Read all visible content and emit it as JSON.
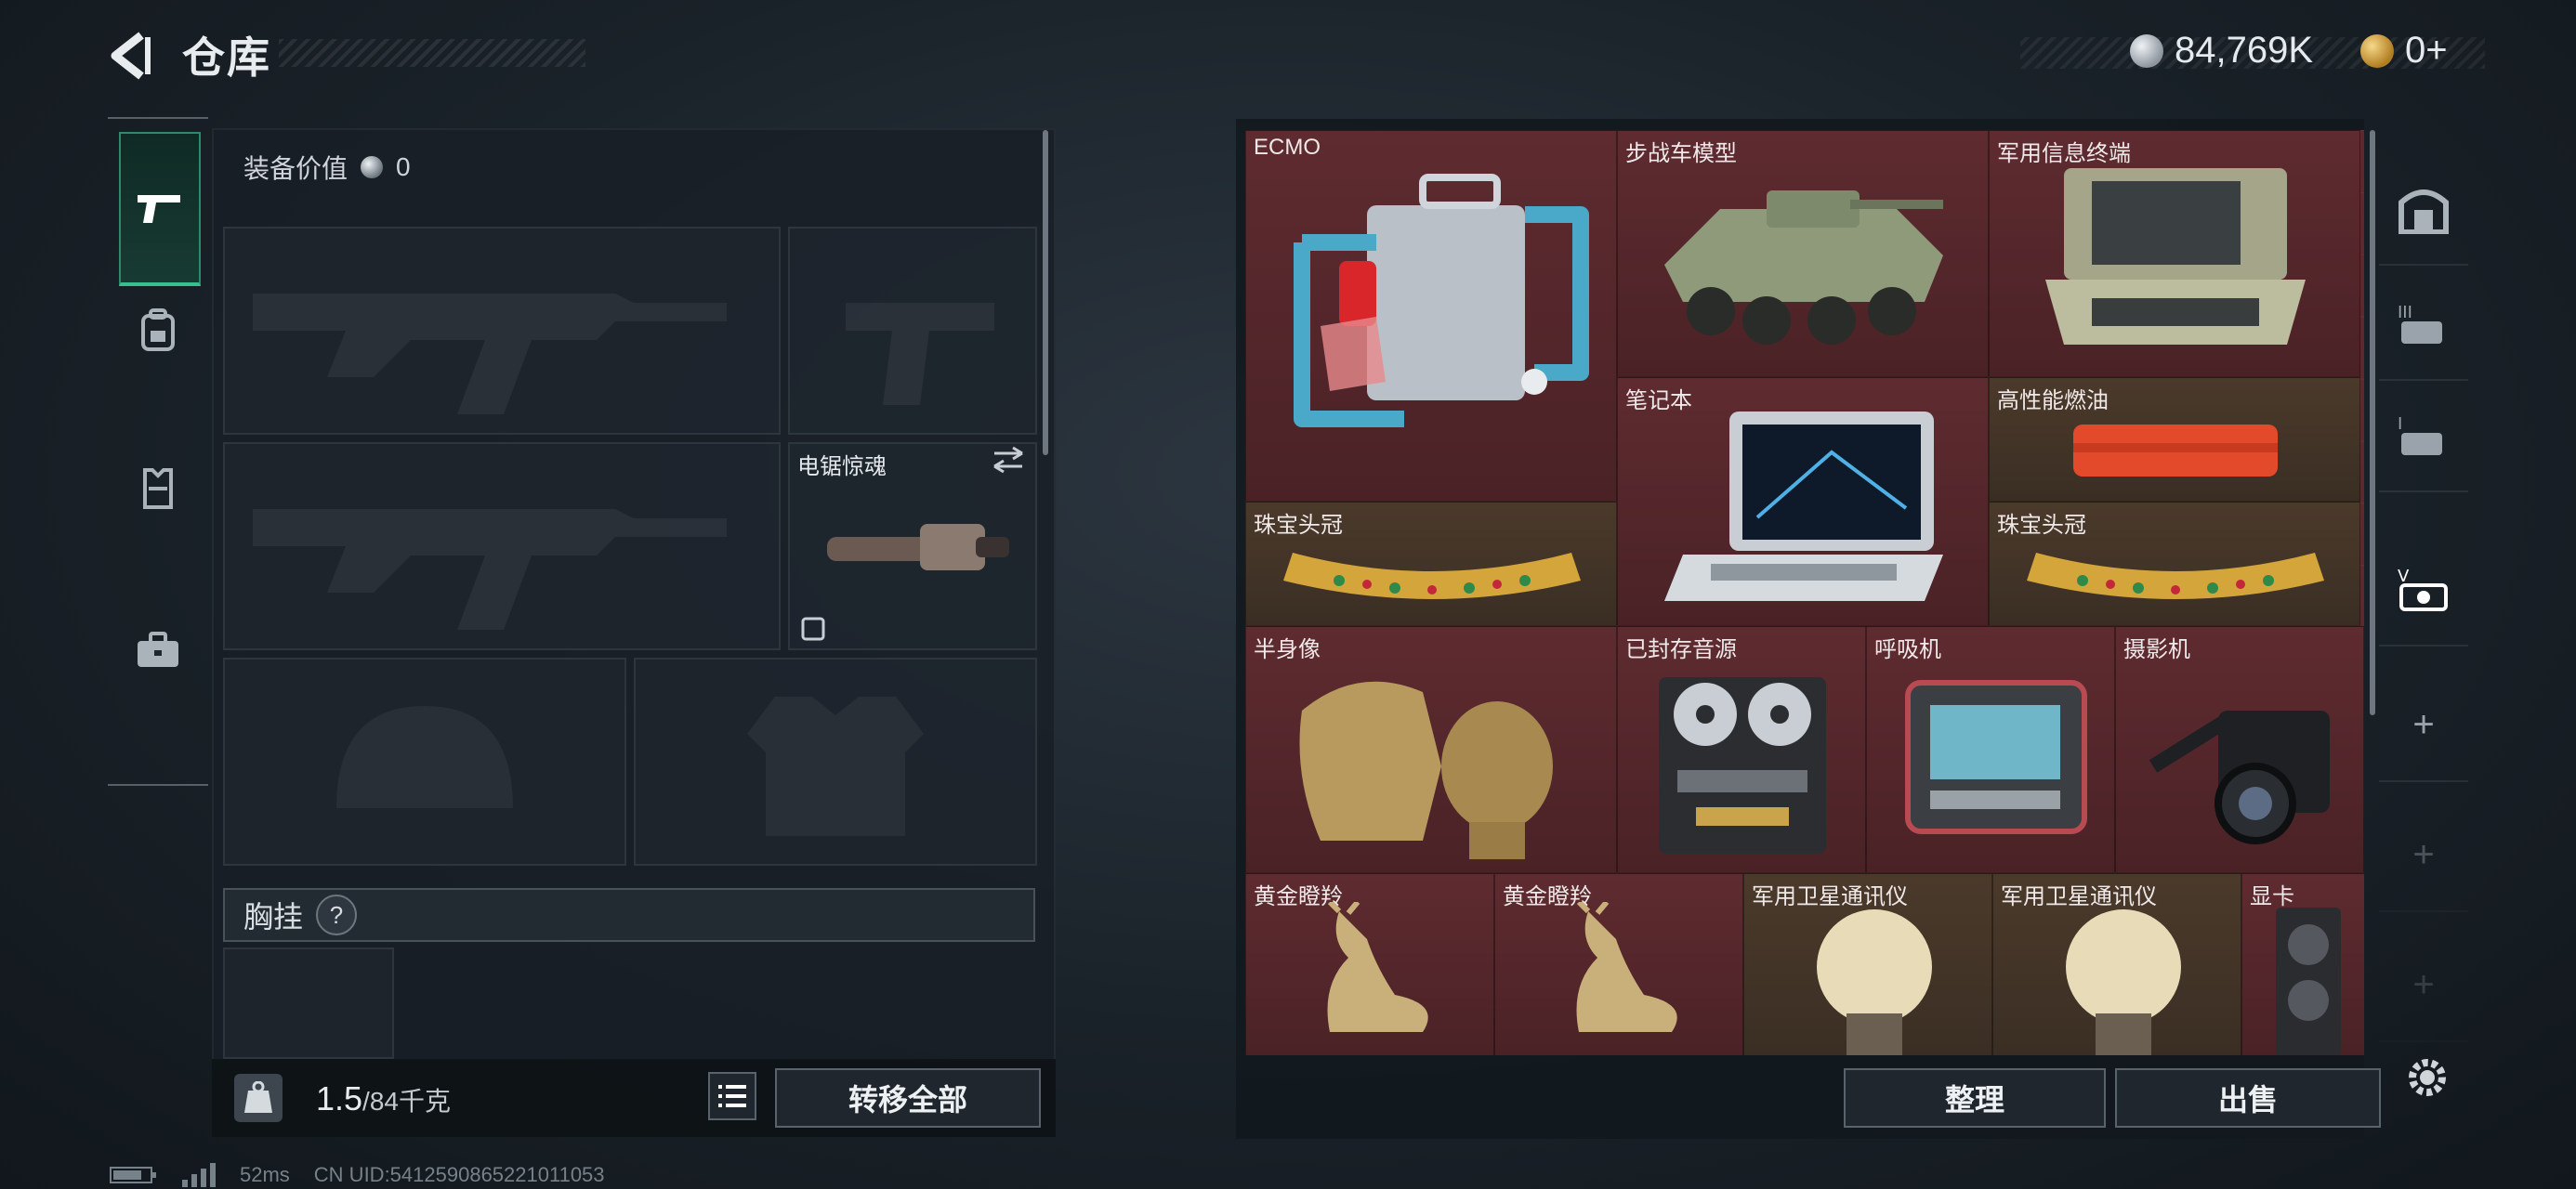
{
  "header": {
    "title": "仓库",
    "currency_main": "84,769K",
    "currency_secondary": "0+"
  },
  "loadout": {
    "value_label": "装备价值",
    "value": "0",
    "melee_name": "电锯惊魂",
    "chest_label": "胸挂",
    "chest_help": "?",
    "weight_current": "1.5",
    "weight_max": "/84千克",
    "transfer_all": "转移全部"
  },
  "stash": {
    "items": [
      {
        "label": "ECMO"
      },
      {
        "label": "步战车模型"
      },
      {
        "label": "军用信息终端"
      },
      {
        "label": "笔记本"
      },
      {
        "label": "高性能燃油"
      },
      {
        "label": "珠宝头冠"
      },
      {
        "label": "珠宝头冠"
      },
      {
        "label": "半身像"
      },
      {
        "label": "已封存音源"
      },
      {
        "label": "呼吸机"
      },
      {
        "label": "摄影机"
      },
      {
        "label": "黄金瞪羚"
      },
      {
        "label": "黄金瞪羚"
      },
      {
        "label": "军用卫星通讯仪"
      },
      {
        "label": "军用卫星通讯仪"
      },
      {
        "label": "显卡"
      }
    ],
    "sort_button": "整理",
    "sell_button": "出售"
  },
  "right_tabs": {
    "add_label": "+"
  },
  "status": {
    "ping": "52ms",
    "uid": "CN UID:5412590865221011053"
  },
  "colors": {
    "item_bg": "#5a2a2e",
    "accent_green": "#37c08f",
    "gold": "#d4a53a"
  }
}
